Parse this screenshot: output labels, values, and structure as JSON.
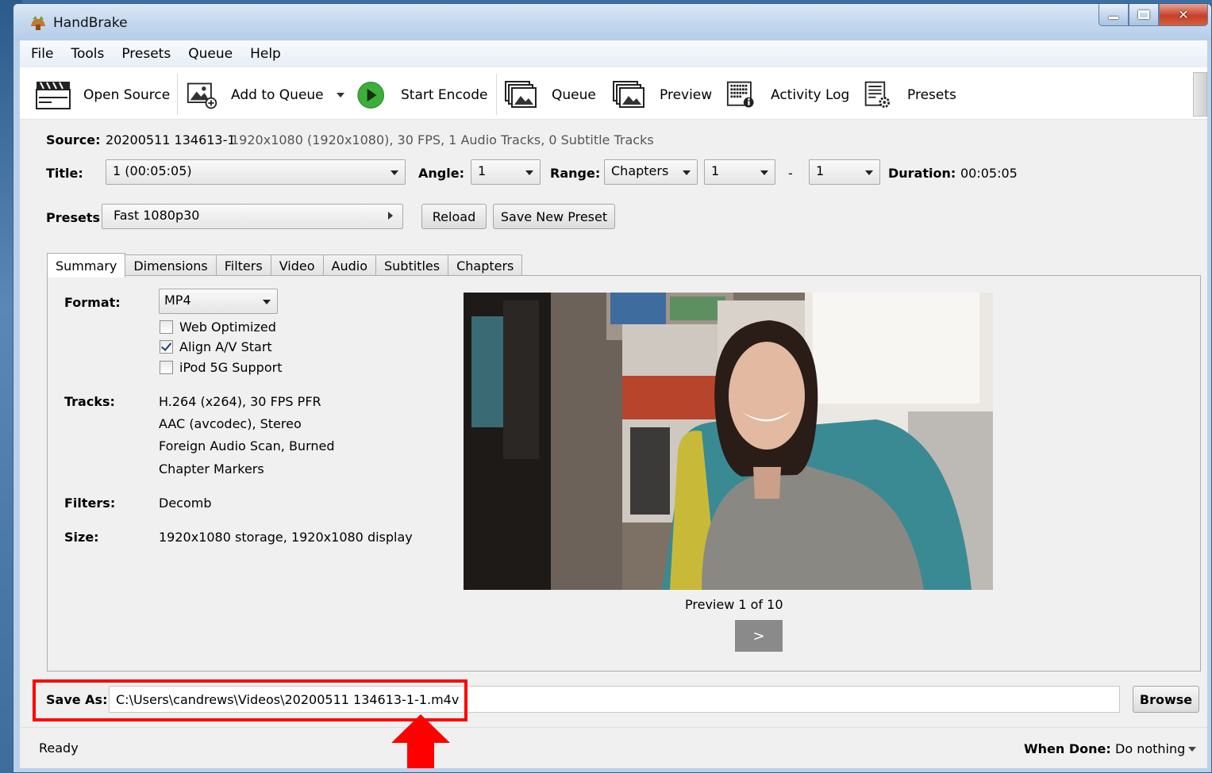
{
  "window": {
    "title": "HandBrake"
  },
  "menu": [
    "File",
    "Tools",
    "Presets",
    "Queue",
    "Help"
  ],
  "toolbar": {
    "open_source": "Open Source",
    "add_to_queue": "Add to Queue",
    "start_encode": "Start Encode",
    "queue": "Queue",
    "preview": "Preview",
    "activity_log": "Activity Log",
    "presets": "Presets"
  },
  "source": {
    "label": "Source:",
    "name": "20200511 134613-1",
    "info": "1920x1080 (1920x1080), 30 FPS, 1 Audio Tracks, 0 Subtitle Tracks"
  },
  "title_row": {
    "title_label": "Title:",
    "title_value": "1 (00:05:05)",
    "angle_label": "Angle:",
    "angle_value": "1",
    "range_label": "Range:",
    "range_value": "Chapters",
    "range_start": "1",
    "range_dash": "-",
    "range_end": "1",
    "duration_label": "Duration:",
    "duration_value": "00:05:05"
  },
  "presets_row": {
    "label": "Presets",
    "value": "Fast 1080p30",
    "reload": "Reload",
    "save_new": "Save New Preset"
  },
  "tabs": [
    "Summary",
    "Dimensions",
    "Filters",
    "Video",
    "Audio",
    "Subtitles",
    "Chapters"
  ],
  "summary": {
    "format_label": "Format:",
    "format_value": "MP4",
    "web_optimized": "Web Optimized",
    "align_av": "Align A/V Start",
    "ipod": "iPod 5G Support",
    "tracks_label": "Tracks:",
    "tracks": [
      "H.264 (x264), 30 FPS PFR",
      "AAC (avcodec), Stereo",
      "Foreign Audio Scan, Burned",
      "Chapter Markers"
    ],
    "filters_label": "Filters:",
    "filters_value": "Decomb",
    "size_label": "Size:",
    "size_value": "1920x1080 storage, 1920x1080 display",
    "preview_caption": "Preview 1 of 10",
    "next": ">"
  },
  "save": {
    "label": "Save As:",
    "path": "C:\\Users\\candrews\\Videos\\20200511 134613-1-1.m4v",
    "browse": "Browse"
  },
  "status": {
    "text": "Ready",
    "when_done_label": "When Done:",
    "when_done_value": "Do nothing"
  },
  "colors": {
    "highlight": "#ff0000",
    "play": "#3cae3a"
  }
}
